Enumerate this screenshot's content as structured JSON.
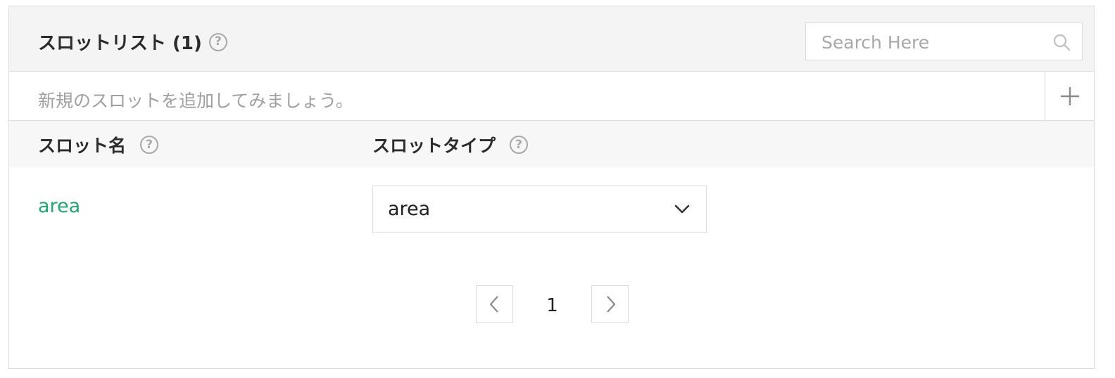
{
  "header": {
    "title": "スロットリスト (1)",
    "help_glyph": "?",
    "search": {
      "placeholder": "Search Here",
      "value": ""
    }
  },
  "add_row": {
    "hint": "新規のスロットを追加してみましょう。"
  },
  "table": {
    "columns": [
      {
        "label": "スロット名"
      },
      {
        "label": "スロットタイプ"
      }
    ],
    "rows": [
      {
        "name": "area",
        "type": "area"
      }
    ]
  },
  "pagination": {
    "current_page": "1"
  },
  "colors": {
    "accent_green": "#1fa971",
    "header_bg": "#f4f4f4",
    "border": "#dcdcdc",
    "muted_text": "#a0a0a0"
  },
  "icons": {
    "help": "question-circle-icon",
    "search": "search-icon",
    "add": "plus-icon",
    "dropdown": "chevron-down-icon",
    "prev": "chevron-left-icon",
    "next": "chevron-right-icon"
  }
}
